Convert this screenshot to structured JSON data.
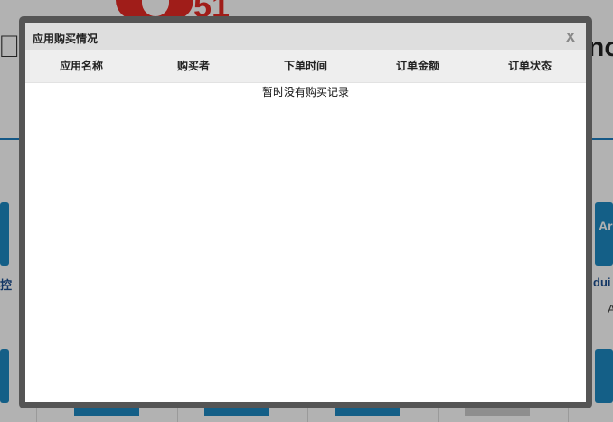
{
  "background": {
    "logo_text": "51",
    "right_heading_fragment": "no",
    "left_caption_fragment": "控",
    "right_caption_fragment": "dui",
    "right_tile_text": "Ar",
    "right_small_text": "A",
    "accent_color": "#1e88c2",
    "logo_color": "#e52a25"
  },
  "modal": {
    "title": "应用购买情况",
    "close_label": "x",
    "columns": [
      "应用名称",
      "购买者",
      "下单时间",
      "订单金额",
      "订单状态"
    ],
    "rows": [],
    "empty_message": "暂时没有购买记录"
  }
}
